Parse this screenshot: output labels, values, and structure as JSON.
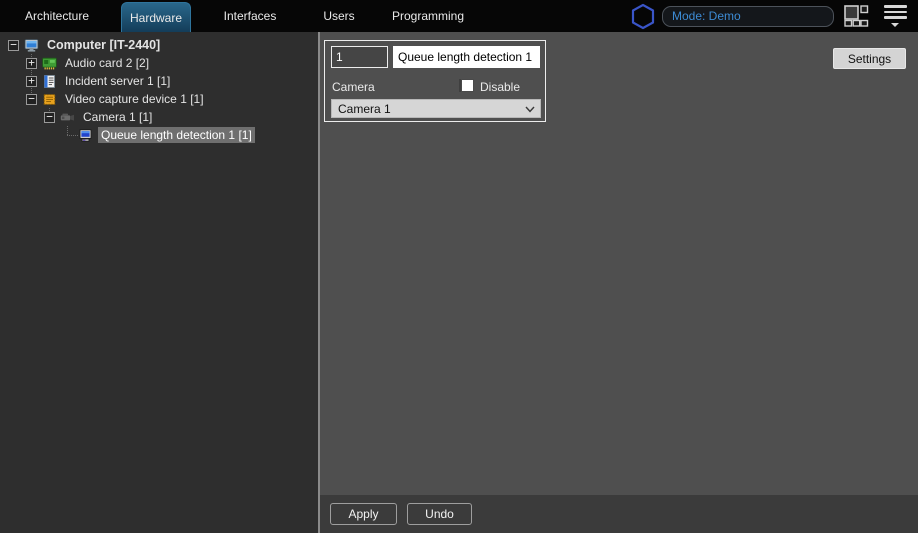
{
  "nav": {
    "tabs": [
      {
        "label": "Architecture",
        "active": false
      },
      {
        "label": "Hardware",
        "active": true
      },
      {
        "label": "Interfaces",
        "active": false
      },
      {
        "label": "Users",
        "active": false
      },
      {
        "label": "Programming",
        "active": false
      }
    ],
    "mode_label": "Mode: Demo"
  },
  "tree": {
    "items": [
      {
        "label": "Computer [IT-2440]",
        "level": 0,
        "expander": "collapse",
        "icon": "computer-icon",
        "selected": false
      },
      {
        "label": "Audio card 2 [2]",
        "level": 1,
        "expander": "expand",
        "icon": "audio-card-icon",
        "selected": false
      },
      {
        "label": "Incident server 1 [1]",
        "level": 1,
        "expander": "expand",
        "icon": "incident-server-icon",
        "selected": false
      },
      {
        "label": "Video capture device 1 [1]",
        "level": 1,
        "expander": "collapse",
        "icon": "video-capture-icon",
        "selected": false
      },
      {
        "label": "Camera 1 [1]",
        "level": 2,
        "expander": "collapse",
        "icon": "camera-icon",
        "selected": false
      },
      {
        "label": "Queue length detection 1 [1]",
        "level": 3,
        "expander": "none",
        "icon": "detection-icon",
        "selected": true
      }
    ],
    "expander_symbols": {
      "collapse": "−",
      "expand": "+"
    }
  },
  "form": {
    "id_value": "1",
    "name_value": "Queue length detection 1",
    "camera_label": "Camera",
    "disable_label": "Disable",
    "disable_checked": false,
    "camera_selected_option": "Camera 1",
    "settings_button_label": "Settings"
  },
  "footer": {
    "apply_label": "Apply",
    "undo_label": "Undo"
  },
  "colors": {
    "navbar_bg": "#060606",
    "active_tab_top": "#29678b",
    "active_tab_bottom": "#143d59",
    "tree_bg": "#2e2e2e",
    "main_bg": "#4f4f4f",
    "footer_bg": "#3b3b3b",
    "selection_bg": "#6f6f6f",
    "mode_text": "#3d8bd4",
    "logo_stroke": "#3a55c8"
  }
}
